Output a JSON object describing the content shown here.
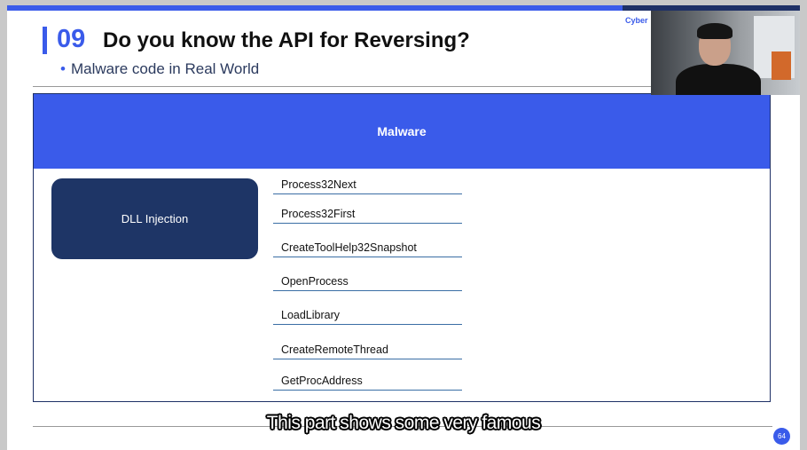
{
  "slide": {
    "brand": "Cyber",
    "section_number": "09",
    "title": "Do you know the API for Reversing?",
    "subtitle": "Malware code in Real World",
    "page_number": "64"
  },
  "diagram": {
    "header": "Malware",
    "category": "DLL Injection",
    "apis": [
      "Process32Next",
      "Process32First",
      "CreateToolHelp32Snapshot",
      "OpenProcess",
      "LoadLibrary",
      "CreateRemoteThread",
      "GetProcAddress"
    ]
  },
  "caption": "This part shows some very famous",
  "colors": {
    "accent": "#3a5bea",
    "navy": "#1e3566",
    "divider": "#3a6ea5"
  }
}
